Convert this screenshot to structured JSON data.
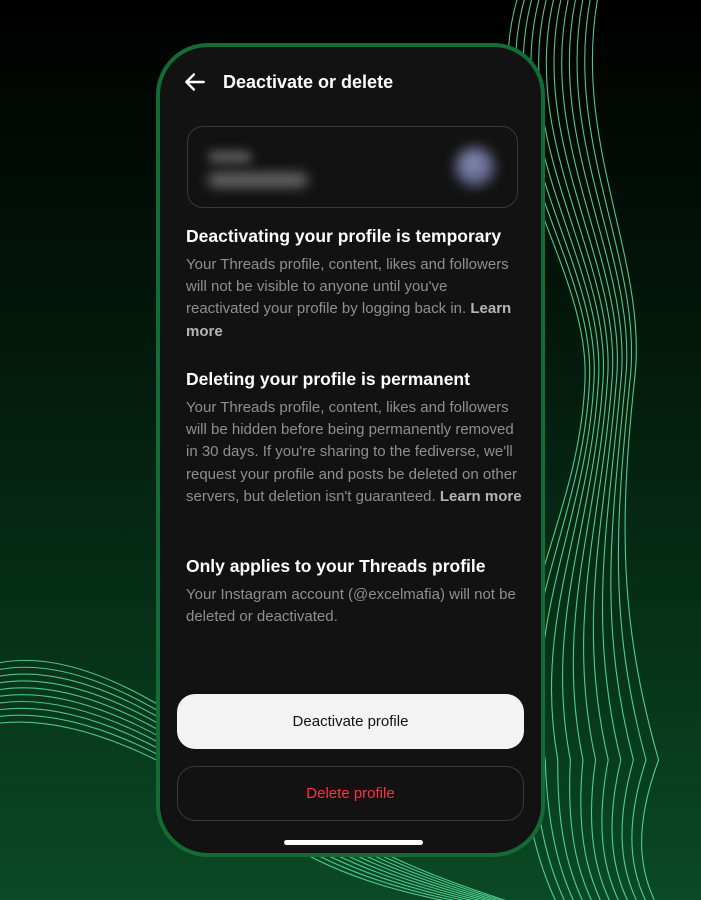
{
  "header": {
    "title": "Deactivate or delete",
    "back_icon": "arrow-left-icon"
  },
  "sections": [
    {
      "heading": "Deactivating your profile is temporary",
      "body": "Your Threads profile, content, likes and followers will not be visible to anyone until you've reactivated your profile by logging back in.",
      "link": "Learn more"
    },
    {
      "heading": "Deleting your profile is permanent",
      "body": "Your Threads profile, content, likes and followers will be hidden before being permanently removed in 30 days. If you're sharing to the fediverse, we'll request your profile and posts be deleted on other servers, but deletion isn't guaranteed.",
      "link": "Learn more"
    },
    {
      "heading": "Only applies to your Threads profile",
      "body": "Your Instagram account (@excelmafia) will not be deleted or deactivated."
    }
  ],
  "buttons": {
    "deactivate": "Deactivate profile",
    "delete": "Delete profile"
  },
  "colors": {
    "accent_border": "#136b36",
    "delete_red": "#ff3040",
    "wave_green": "#5ee8a6"
  }
}
